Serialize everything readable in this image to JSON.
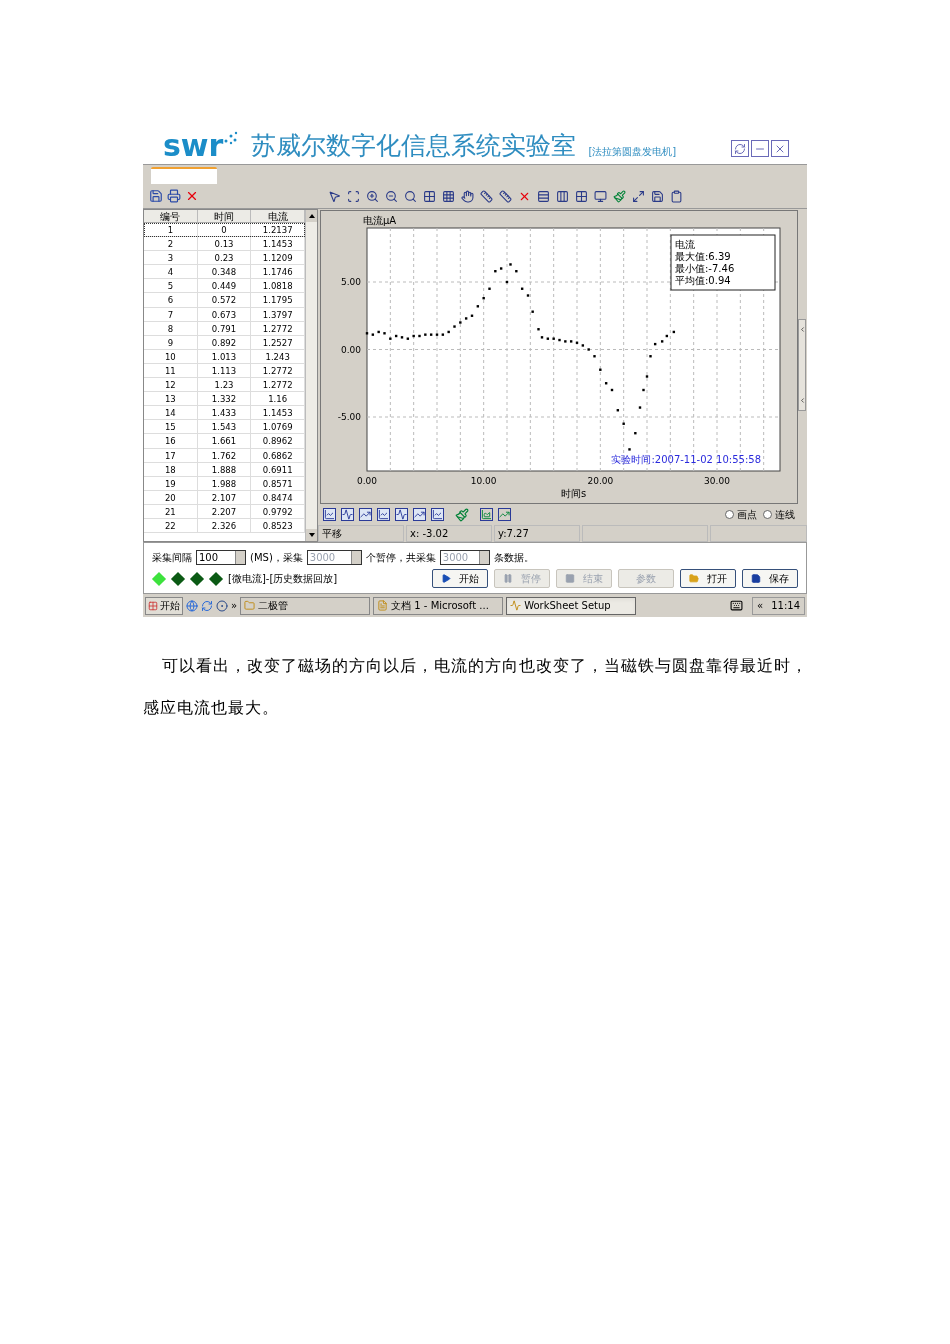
{
  "header": {
    "logo": "swr",
    "title": "苏威尔数字化信息系统实验室",
    "subtitle": "[法拉第圆盘发电机]"
  },
  "table": {
    "columns": [
      "编号",
      "时间",
      "电流"
    ],
    "rows": [
      {
        "cells": [
          "1",
          "0",
          "1.2137"
        ],
        "selected": true
      },
      {
        "cells": [
          "2",
          "0.13",
          "1.1453"
        ],
        "selected": false
      },
      {
        "cells": [
          "3",
          "0.23",
          "1.1209"
        ],
        "selected": false
      },
      {
        "cells": [
          "4",
          "0.348",
          "1.1746"
        ],
        "selected": false
      },
      {
        "cells": [
          "5",
          "0.449",
          "1.0818"
        ],
        "selected": false
      },
      {
        "cells": [
          "6",
          "0.572",
          "1.1795"
        ],
        "selected": false
      },
      {
        "cells": [
          "7",
          "0.673",
          "1.3797"
        ],
        "selected": false
      },
      {
        "cells": [
          "8",
          "0.791",
          "1.2772"
        ],
        "selected": false
      },
      {
        "cells": [
          "9",
          "0.892",
          "1.2527"
        ],
        "selected": false
      },
      {
        "cells": [
          "10",
          "1.013",
          "1.243"
        ],
        "selected": false
      },
      {
        "cells": [
          "11",
          "1.113",
          "1.2772"
        ],
        "selected": false
      },
      {
        "cells": [
          "12",
          "1.23",
          "1.2772"
        ],
        "selected": false
      },
      {
        "cells": [
          "13",
          "1.332",
          "1.16"
        ],
        "selected": false
      },
      {
        "cells": [
          "14",
          "1.433",
          "1.1453"
        ],
        "selected": false
      },
      {
        "cells": [
          "15",
          "1.543",
          "1.0769"
        ],
        "selected": false
      },
      {
        "cells": [
          "16",
          "1.661",
          "0.8962"
        ],
        "selected": false
      },
      {
        "cells": [
          "17",
          "1.762",
          "0.6862"
        ],
        "selected": false
      },
      {
        "cells": [
          "18",
          "1.888",
          "0.6911"
        ],
        "selected": false
      },
      {
        "cells": [
          "19",
          "1.988",
          "0.8571"
        ],
        "selected": false
      },
      {
        "cells": [
          "20",
          "2.107",
          "0.8474"
        ],
        "selected": false
      },
      {
        "cells": [
          "21",
          "2.207",
          "0.9792"
        ],
        "selected": false
      },
      {
        "cells": [
          "22",
          "2.326",
          "0.8523"
        ],
        "selected": false
      }
    ]
  },
  "chart": {
    "legend": [
      "最大值:6.39",
      "最小值:-7.46",
      "平均值:0.94"
    ],
    "timestamp": "实验时间:2007-11-02 10:55:58",
    "chart_data": {
      "type": "scatter",
      "grid": true,
      "xlabel": "时间s",
      "ylabel": "电流μA",
      "xlim": [
        0,
        35.4
      ],
      "ylim": [
        -9,
        9
      ],
      "xticks": [
        {
          "value": 0,
          "label": "0.00"
        },
        {
          "value": 10,
          "label": "10.00"
        },
        {
          "value": 20,
          "label": "20.00"
        },
        {
          "value": 30,
          "label": "30.00"
        }
      ],
      "yticks": [
        {
          "value": -5,
          "label": "-5.00"
        },
        {
          "value": 0,
          "label": "0.00"
        },
        {
          "value": 5,
          "label": "5.00"
        }
      ],
      "x": [
        0,
        0.5,
        1,
        1.5,
        2,
        2.5,
        3,
        3.5,
        4,
        4.5,
        5,
        5.5,
        6,
        6.5,
        7,
        7.5,
        8,
        8.5,
        9,
        9.5,
        10,
        10.5,
        11,
        11.5,
        12,
        12.3,
        12.8,
        13.3,
        13.8,
        14.2,
        14.7,
        15,
        15.5,
        16,
        16.5,
        17,
        17.5,
        18,
        18.5,
        19,
        19.5,
        20,
        20.5,
        21,
        21.5,
        22,
        22.5,
        23,
        23.4,
        23.7,
        24,
        24.3,
        24.7,
        25.3,
        25.7,
        26.3
      ],
      "series": [
        {
          "name": "电流",
          "color": "#000000",
          "values": [
            1.2,
            1.1,
            1.3,
            1.2,
            0.8,
            1.0,
            0.9,
            0.8,
            1.0,
            1.0,
            1.1,
            1.1,
            1.1,
            1.1,
            1.3,
            1.7,
            2.0,
            2.3,
            2.5,
            3.2,
            3.8,
            4.5,
            5.8,
            6.0,
            5.0,
            6.3,
            5.8,
            4.5,
            4.0,
            2.8,
            1.5,
            0.9,
            0.8,
            0.8,
            0.7,
            0.6,
            0.6,
            0.5,
            0.3,
            0.0,
            -0.5,
            -1.5,
            -2.5,
            -3.0,
            -4.5,
            -5.5,
            -7.4,
            -6.2,
            -4.3,
            -3.0,
            -2.0,
            -0.5,
            0.4,
            0.6,
            1.0,
            1.3
          ]
        }
      ]
    }
  },
  "radios": [
    {
      "label": "画点",
      "selected": false
    },
    {
      "label": "连线",
      "selected": false
    }
  ],
  "status": [
    "平移",
    "x: -3.02",
    "y:7.27"
  ],
  "controls": {
    "interval_label": "采集间隔",
    "interval": "100",
    "unit_text": "(MS)，采集",
    "count": "3000",
    "pause_text": "个暂停，共采集",
    "total": "3000",
    "total_suffix": "条数据。",
    "count_disabled": true,
    "total_disabled": true
  },
  "indicators": [
    {
      "on": true
    },
    {
      "on": false
    },
    {
      "on": false
    },
    {
      "on": false
    }
  ],
  "mode_text": "[微电流]-[历史数据回放]",
  "buttons": [
    {
      "label": "开始",
      "kind": "play",
      "disabled": false
    },
    {
      "label": "暂停",
      "kind": "pause",
      "disabled": true
    },
    {
      "label": "结束",
      "kind": "stop",
      "disabled": true
    },
    {
      "label": "参数",
      "kind": "plain",
      "disabled": true
    },
    {
      "label": "打开",
      "kind": "open",
      "disabled": false
    },
    {
      "label": "保存",
      "kind": "save",
      "disabled": false
    }
  ],
  "taskbar": {
    "start": "开始",
    "more": "»",
    "items": [
      {
        "label": "二极管",
        "kind": "folder",
        "selected": false
      },
      {
        "label": "文档 1 - Microsoft ...",
        "kind": "doc",
        "selected": false
      },
      {
        "label": "WorkSheet Setup",
        "kind": "app",
        "selected": true
      }
    ],
    "tray_more": "«",
    "clock": "11:14"
  },
  "paragraph": "可以看出，改变了磁场的方向以后，电流的方向也改变了，当磁铁与圆盘靠得最近时，感应电流也最大。"
}
